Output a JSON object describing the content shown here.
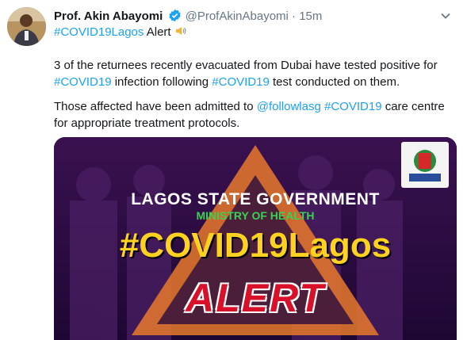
{
  "tweet": {
    "author_name": "Prof. Akin Abayomi",
    "handle": "@ProfAkinAbayomi",
    "separator": "·",
    "timestamp": "15m",
    "line1": {
      "hashtag": "#COVID19Lagos",
      "text": " Alert"
    },
    "para1": {
      "a": "3 of the returnees recently evacuated from Dubai have tested positive for",
      "b_tag": "#COVID19",
      "b_text1": " infection following ",
      "b_tag2": "#COVID19",
      "b_text2": " test conducted on them."
    },
    "para2": {
      "a": "Those affected have been admitted to ",
      "mention": "@followlasg",
      "space": " ",
      "tag": "#COVID19",
      "a_end": " care centre",
      "b": "for appropriate treatment protocols."
    }
  },
  "media": {
    "gov": "LAGOS STATE GOVERNMENT",
    "ministry": "MINISTRY OF HEALTH",
    "hashtag": "#COVID19Lagos",
    "alert": "ALERT"
  },
  "icons": {
    "verified": "verified-badge-icon",
    "speaker": "speaker-icon",
    "caret": "chevron-down-icon"
  },
  "colors": {
    "link": "#1da1f2",
    "muted": "#657786",
    "ministry_green": "#39d353",
    "alert_red": "#d8102a",
    "warning_orange": "#e8792b"
  }
}
